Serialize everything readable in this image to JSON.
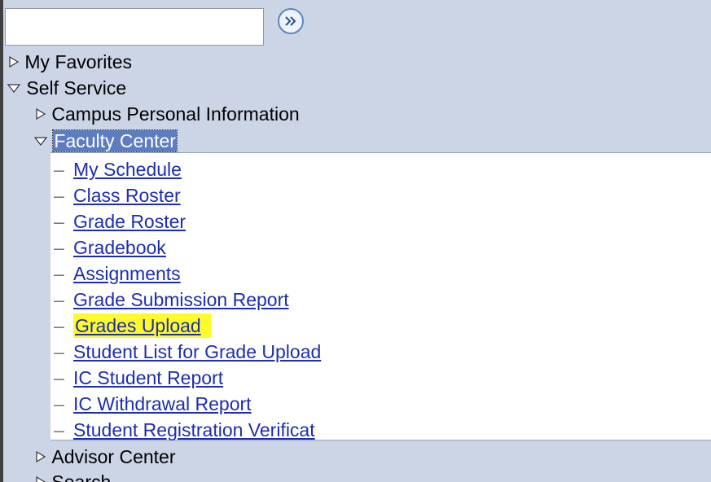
{
  "search": {
    "value": "",
    "placeholder": ""
  },
  "menu": {
    "my_favorites": "My Favorites",
    "self_service": "Self Service",
    "campus_personal_information": "Campus Personal Information",
    "faculty_center": "Faculty Center",
    "faculty_links": [
      "My Schedule",
      "Class Roster",
      "Grade Roster",
      "Gradebook",
      "Assignments",
      "Grade Submission Report",
      "Grades Upload",
      "Student List for Grade Upload",
      "IC Student Report",
      "IC Withdrawal Report",
      "Student Registration Verificat"
    ],
    "highlighted_link": "Grades Upload",
    "advisor_center": "Advisor Center",
    "search_item": "Search"
  },
  "colors": {
    "background": "#ccd5e6",
    "selected": "#5e7dc0",
    "link": "#1d2db0",
    "highlight": "#fdfb2c"
  }
}
